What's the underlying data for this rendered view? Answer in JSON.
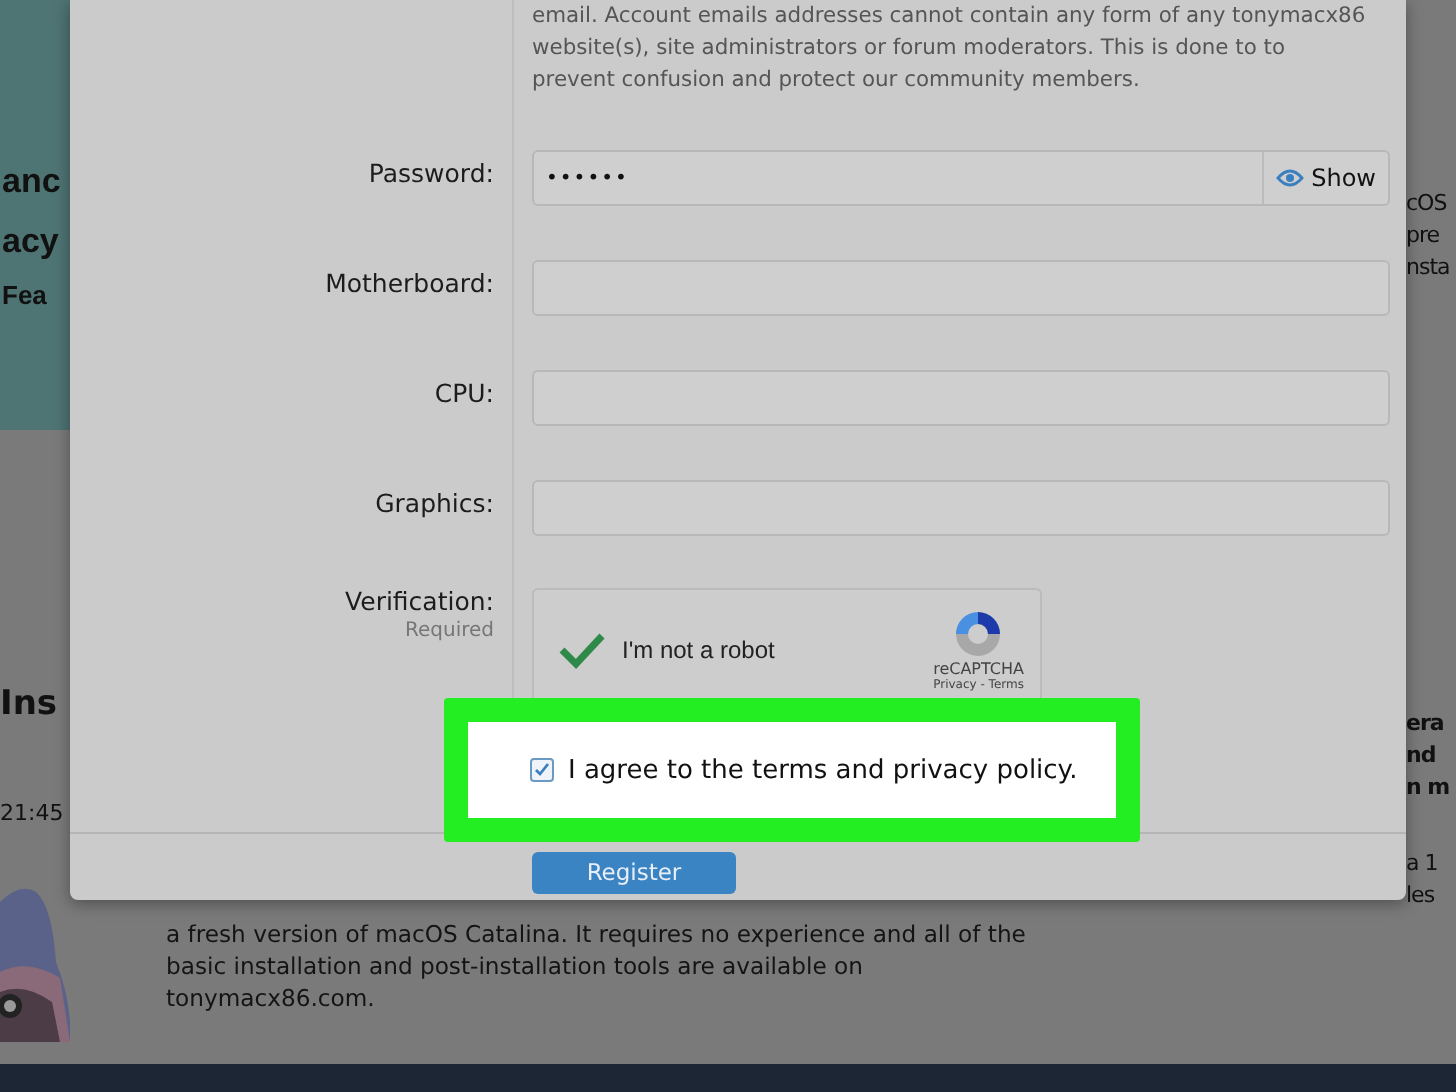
{
  "background": {
    "banner_lines": [
      "anc",
      "acy",
      "Fea"
    ],
    "left_heading": "Ins",
    "left_time": "21:45",
    "article_lines": [
      "a fresh version of macOS Catalina. It requires no experience and all of the",
      "basic installation and post-installation tools are available on",
      "tonymacx86.com."
    ],
    "right_top_lines": [
      "cOS",
      "pre",
      "nsta"
    ],
    "right_heading_lines": [
      "era",
      "nd",
      "n m"
    ],
    "right_body_lines": [
      "a 1",
      "les"
    ]
  },
  "intro_lines": [
    "email. Account emails addresses cannot contain any form of any tonymacx86",
    "website(s), site administrators or forum moderators. This is done to to",
    "prevent confusion and protect our community members."
  ],
  "fields": [
    {
      "label": "Password:",
      "kind": "password",
      "value": "••••••",
      "toggle": "Show"
    },
    {
      "label": "Motherboard:",
      "kind": "text"
    },
    {
      "label": "CPU:",
      "kind": "text"
    },
    {
      "label": "Graphics:",
      "kind": "text"
    }
  ],
  "verification": {
    "label": "Verification:",
    "hint": "Required",
    "checkbox_label": "I'm not a robot",
    "checked": true,
    "brand": "reCAPTCHA",
    "links": "Privacy - Terms"
  },
  "agree": {
    "label": "I agree to the terms and privacy policy.",
    "checked": true
  },
  "register_button": "Register"
}
